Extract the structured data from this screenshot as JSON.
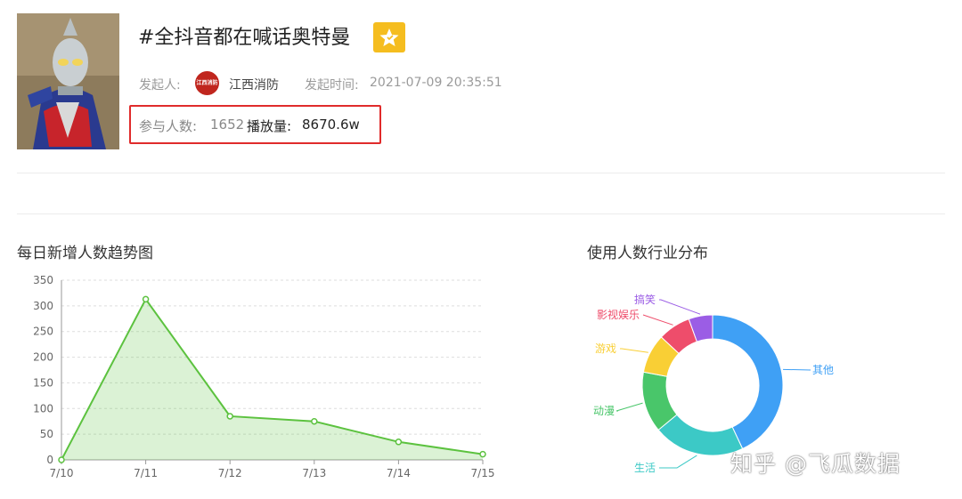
{
  "header": {
    "title": "#全抖音都在喊话奥特曼",
    "initiator_label": "发起人:",
    "initiator_avatar_text": "江西消防",
    "initiator_name": "江西消防",
    "time_label": "发起时间:",
    "time_value": "2021-07-09 20:35:51",
    "participants_label": "参与人数:",
    "participants_value": "1652",
    "plays_label": "播放量:",
    "plays_value": "8670.6w",
    "badge_color": "#f5bd1f",
    "highlight_color": "#e02b2b"
  },
  "trend": {
    "title": "每日新增人数趋势图"
  },
  "industry": {
    "title": "使用人数行业分布"
  },
  "watermark": "知乎 @飞瓜数据",
  "chart_data": [
    {
      "type": "area",
      "title": "每日新增人数趋势图",
      "categories": [
        "7/10",
        "7/11",
        "7/12",
        "7/13",
        "7/14",
        "7/15"
      ],
      "values": [
        0,
        313,
        85,
        75,
        35,
        11
      ],
      "ylim": [
        0,
        350
      ],
      "yticks": [
        0,
        50,
        100,
        150,
        200,
        250,
        300,
        350
      ],
      "grid": true,
      "color": "#5cc23f"
    },
    {
      "type": "pie",
      "title": "使用人数行业分布",
      "slices": [
        {
          "label": "其他",
          "value": 43,
          "color": "#3fa0f5"
        },
        {
          "label": "生活",
          "value": 21,
          "color": "#3cc9c6"
        },
        {
          "label": "动漫",
          "value": 14,
          "color": "#49c66a"
        },
        {
          "label": "游戏",
          "value": 9,
          "color": "#f9cf35"
        },
        {
          "label": "影视娱乐",
          "value": 7.5,
          "color": "#ee4d6b"
        },
        {
          "label": "搞笑",
          "value": 5.5,
          "color": "#9b5de5"
        }
      ]
    }
  ]
}
